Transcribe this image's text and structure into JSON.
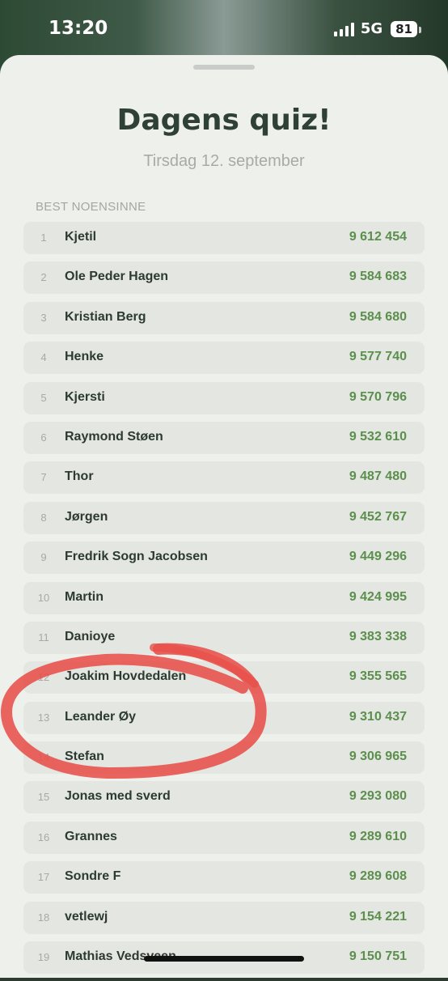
{
  "status_bar": {
    "time": "13:20",
    "network": "5G",
    "battery": "81"
  },
  "header": {
    "title": "Dagens quiz!",
    "date": "Tirsdag 12. september"
  },
  "section_label": "BEST NOENSINNE",
  "leaderboard": [
    {
      "rank": "1",
      "name": "Kjetil",
      "score": "9 612 454"
    },
    {
      "rank": "2",
      "name": "Ole Peder Hagen",
      "score": "9 584 683"
    },
    {
      "rank": "3",
      "name": "Kristian Berg",
      "score": "9 584 680"
    },
    {
      "rank": "4",
      "name": "Henke",
      "score": "9 577 740"
    },
    {
      "rank": "5",
      "name": "Kjersti",
      "score": "9 570 796"
    },
    {
      "rank": "6",
      "name": "Raymond Støen",
      "score": "9 532 610"
    },
    {
      "rank": "7",
      "name": "Thor",
      "score": "9 487 480"
    },
    {
      "rank": "8",
      "name": "Jørgen",
      "score": "9 452 767"
    },
    {
      "rank": "9",
      "name": "Fredrik Sogn Jacobsen",
      "score": "9 449 296"
    },
    {
      "rank": "10",
      "name": "Martin",
      "score": "9 424 995"
    },
    {
      "rank": "11",
      "name": "Danioye",
      "score": "9 383 338"
    },
    {
      "rank": "12",
      "name": "Joakim Hovdedalen",
      "score": "9 355 565"
    },
    {
      "rank": "13",
      "name": "Leander Øy",
      "score": "9 310 437"
    },
    {
      "rank": "14",
      "name": "Stefan",
      "score": "9 306 965"
    },
    {
      "rank": "15",
      "name": "Jonas med sverd",
      "score": "9 293 080"
    },
    {
      "rank": "16",
      "name": "Grannes",
      "score": "9 289 610"
    },
    {
      "rank": "17",
      "name": "Sondre F",
      "score": "9 289 608"
    },
    {
      "rank": "18",
      "name": "vetlewj",
      "score": "9 154 221"
    },
    {
      "rank": "19",
      "name": "Mathias Vedsveen",
      "score": "9 150 751"
    }
  ],
  "colors": {
    "accent_green": "#5b8f4c",
    "annotation_red": "#e8504a"
  }
}
